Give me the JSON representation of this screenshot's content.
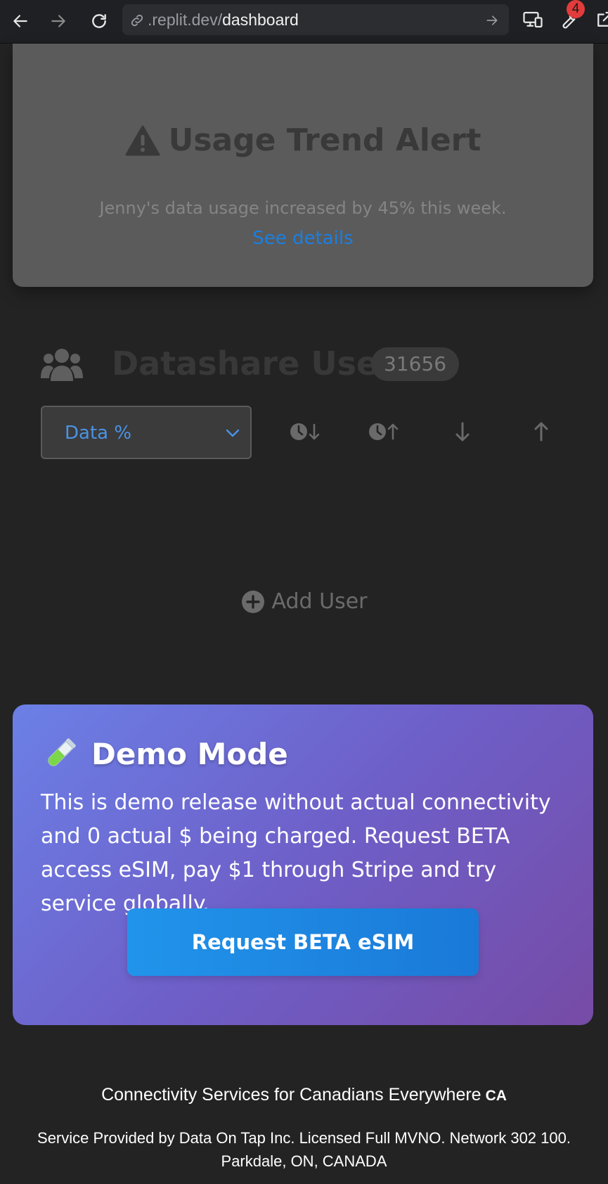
{
  "browser": {
    "url_domain": ".replit.dev/",
    "url_path": "dashboard",
    "extensions_badge": "4"
  },
  "alert": {
    "title": "Usage Trend Alert",
    "message": "Jenny's data usage increased by 45% this week.",
    "link": "See details"
  },
  "users": {
    "title": "Datashare Users",
    "count": "31656",
    "sort_select_value": "Data %",
    "add_user_label": "Add User"
  },
  "demo": {
    "title": "Demo Mode",
    "message": "This is demo release without actual connectivity and 0 actual $ being charged. Request BETA access eSIM, pay $1 through Stripe and try service globally.",
    "button": "Request BETA eSIM"
  },
  "footer": {
    "tagline": "Connectivity Services for Canadians Everywhere",
    "country_code": "CA",
    "legal": "Service Provided by Data On Tap Inc. Licensed Full MVNO. Network 302 100. Parkdale, ON, CANADA"
  },
  "colors": {
    "accent_blue": "#1b7fe0",
    "demo_gradient_start": "#6b80e6",
    "demo_gradient_end": "#764ba6",
    "badge_red": "#e23b3b"
  },
  "icons": [
    "back-icon",
    "forward-icon",
    "reload-icon",
    "link-icon",
    "go-icon",
    "devices-icon",
    "wrench-icon",
    "external-icon",
    "warning-icon",
    "users-icon",
    "chevron-down-icon",
    "clock-sort-down-icon",
    "clock-sort-up-icon",
    "arrow-down-icon",
    "arrow-up-icon",
    "plus-circle-icon",
    "test-tube-icon"
  ]
}
